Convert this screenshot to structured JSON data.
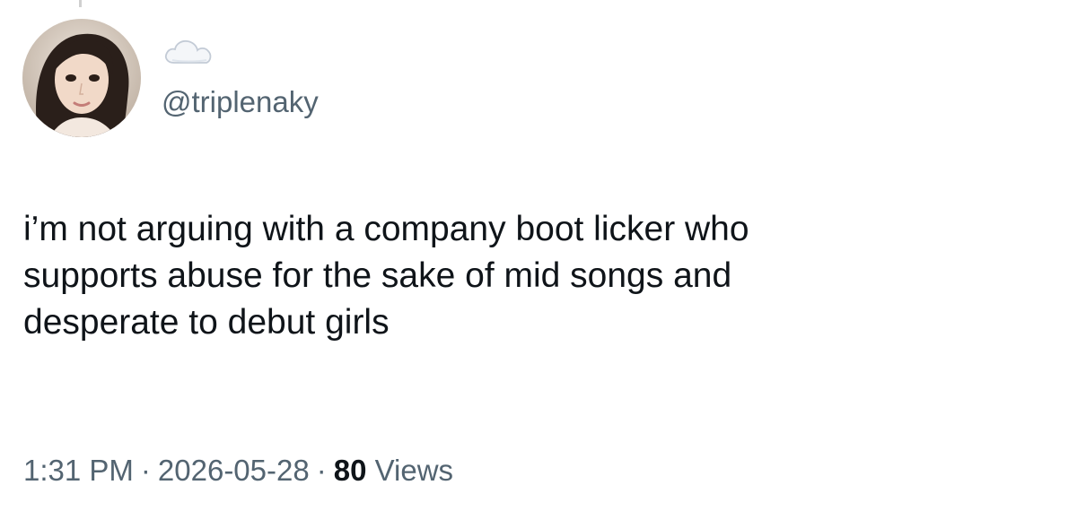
{
  "author": {
    "avatar_icon": "profile-photo",
    "name_icon": "cloud-emoji-icon",
    "handle": "@triplenaky"
  },
  "tweet": {
    "lines": [
      "i’m not arguing with a company boot licker who",
      "supports abuse for the sake of mid songs and",
      "desperate to debut girls"
    ]
  },
  "meta": {
    "time": "1:31 PM",
    "date": "2026-05-28",
    "separator": "·",
    "views_count": "80",
    "views_label": "Views"
  },
  "colors": {
    "text": "#0f1419",
    "secondary": "#536471",
    "background": "#ffffff"
  }
}
